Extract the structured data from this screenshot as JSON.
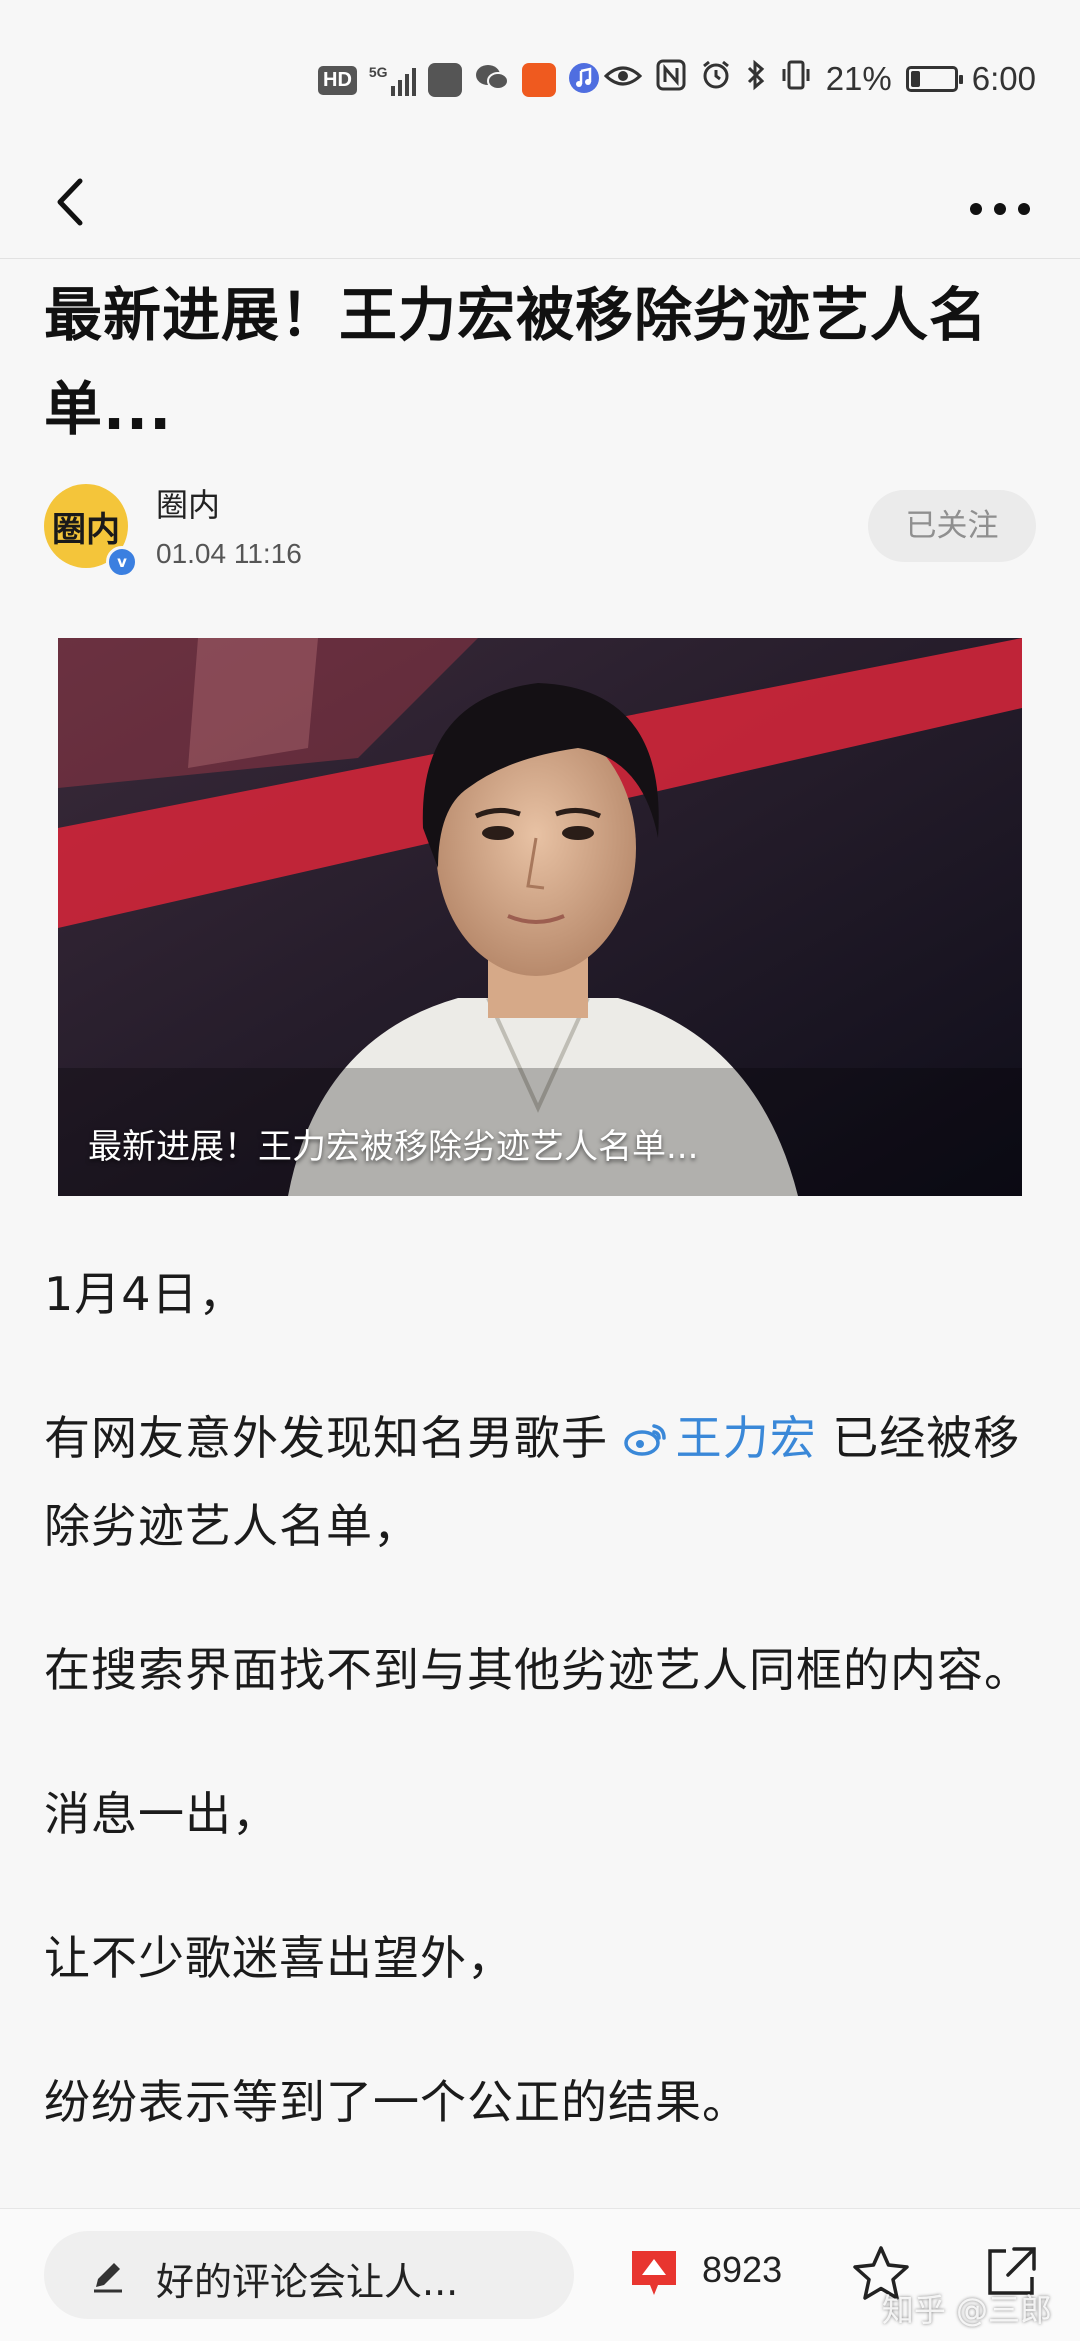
{
  "status_bar": {
    "hd": "HD",
    "network": "5G",
    "battery_percent": "21%",
    "battery_level": 0.21,
    "time": "6:00",
    "icons": [
      "hd-icon",
      "signal-icon",
      "huawei-app-icon",
      "wechat-icon",
      "app-icon",
      "music-icon",
      "eye-icon",
      "nfc-icon",
      "alarm-icon",
      "bluetooth-icon",
      "vibrate-icon",
      "battery-icon"
    ]
  },
  "nav": {
    "back_icon": "back-arrow-icon",
    "more_icon": "more-dots-icon"
  },
  "article": {
    "title": "最新进展！王力宏被移除劣迹艺人名单...",
    "author": {
      "name": "圈内",
      "avatar_text": "圈内",
      "time": "01.04  11:16",
      "follow_label": "已关注"
    },
    "image_caption": "最新进展！王力宏被移除劣迹艺人名单...",
    "paragraphs": {
      "p1": "1月4日，",
      "p2_before": "有网友意外发现知名男歌手 ",
      "p2_mention": "王力宏",
      "p2_after": " 已经被移除劣迹艺人名单，",
      "p3": "在搜索界面找不到与其他劣迹艺人同框的内容。",
      "p4": "消息一出，",
      "p5": "让不少歌迷喜出望外，",
      "p6": "纷纷表示等到了一个公正的结果。"
    }
  },
  "bottom_bar": {
    "comment_placeholder": "好的评论会让人...",
    "like_count": "8923",
    "watermark": "知乎 @三郎"
  },
  "colors": {
    "accent_link": "#3a88d8",
    "like_red": "#e8352f",
    "verified_blue": "#3b7fe0"
  }
}
